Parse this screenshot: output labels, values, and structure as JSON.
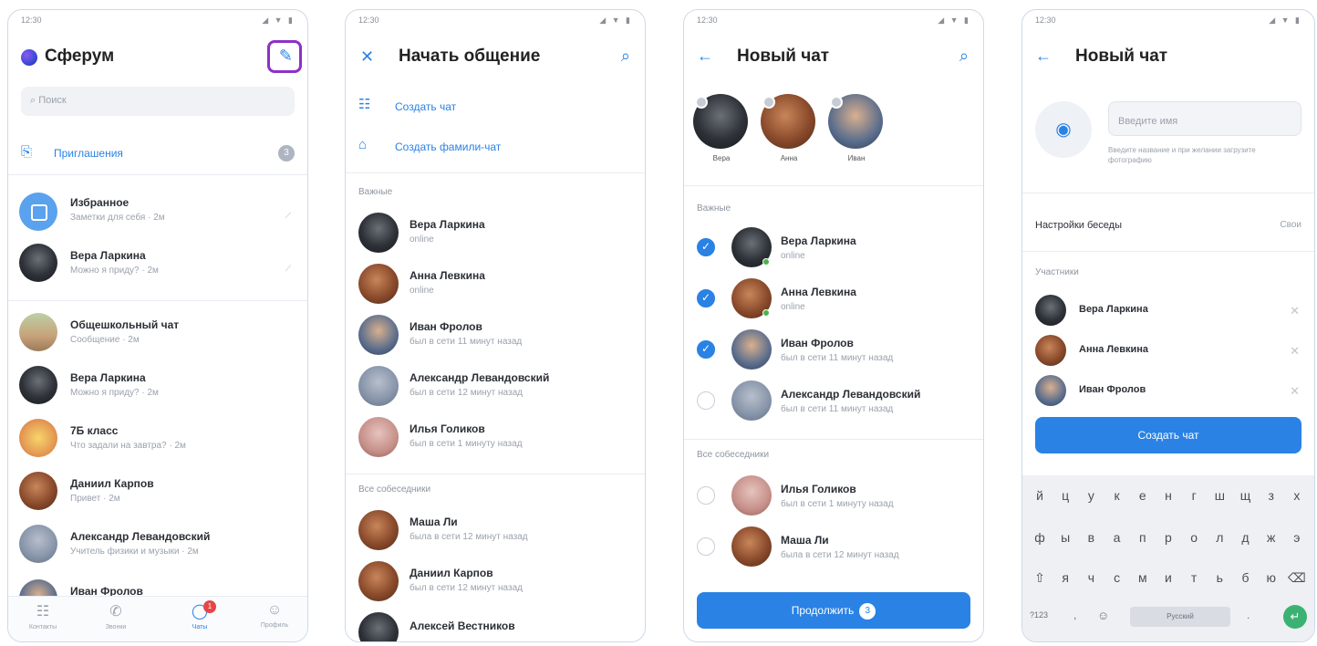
{
  "status": {
    "time": "12:30",
    "icons": "◢ ▼ ▮"
  },
  "screen1": {
    "title": "Сферум",
    "search_placeholder": "Поиск",
    "invitations_label": "Приглашения",
    "invitations_count": "3",
    "chats": [
      {
        "name": "Избранное",
        "sub": "Заметки для себя · 2м"
      },
      {
        "name": "Вера Ларкина",
        "sub": "Можно я приду? · 2м"
      },
      {
        "name": "Общешкольный чат",
        "sub": "Сообщение · 2м"
      },
      {
        "name": "Вера Ларкина",
        "sub": "Можно я приду? · 2м"
      },
      {
        "name": "7Б класс",
        "sub": "Что задали на завтра? · 2м"
      },
      {
        "name": "Даниил Карпов",
        "sub": "Привет · 2м"
      },
      {
        "name": "Александр Левандовский",
        "sub": "Учитель физики и музыки · 2м"
      },
      {
        "name": "Иван Фролов",
        "sub": ""
      }
    ],
    "tabs": [
      "Контакты",
      "Звонки",
      "Чаты",
      "Профиль"
    ],
    "tab_badge": "1"
  },
  "screen2": {
    "title": "Начать общение",
    "actions": [
      "Создать чат",
      "Создать фамили-чат"
    ],
    "section_important": "Важные",
    "important": [
      {
        "name": "Вера Ларкина",
        "sub": "online"
      },
      {
        "name": "Анна Левкина",
        "sub": "online"
      },
      {
        "name": "Иван Фролов",
        "sub": "был в сети 11 минут назад"
      },
      {
        "name": "Александр Левандовский",
        "sub": "был в сети 12 минут назад"
      },
      {
        "name": "Илья Голиков",
        "sub": "был в сети 1 минуту назад"
      }
    ],
    "section_all": "Все собеседники",
    "all": [
      {
        "name": "Маша Ли",
        "sub": "была в сети 12 минут назад"
      },
      {
        "name": "Даниил Карпов",
        "sub": "был в сети 12 минут назад"
      },
      {
        "name": "Алексей Вестников",
        "sub": ""
      }
    ]
  },
  "screen3": {
    "title": "Новый чат",
    "selected": [
      "Вера",
      "Анна",
      "Иван"
    ],
    "section_important": "Важные",
    "important": [
      {
        "name": "Вера Ларкина",
        "sub": "online",
        "checked": true
      },
      {
        "name": "Анна Левкина",
        "sub": "online",
        "checked": true
      },
      {
        "name": "Иван Фролов",
        "sub": "был в сети 11 минут назад",
        "checked": true
      },
      {
        "name": "Александр Левандовский",
        "sub": "был в сети 11 минут назад",
        "checked": false
      }
    ],
    "section_all": "Все собеседники",
    "all": [
      {
        "name": "Илья Голиков",
        "sub": "был в сети 1 минуту назад",
        "checked": false
      },
      {
        "name": "Маша Ли",
        "sub": "была в сети 12 минут назад",
        "checked": false
      }
    ],
    "continue_label": "Продолжить",
    "continue_count": "3"
  },
  "screen4": {
    "title": "Новый чат",
    "name_placeholder": "Введите имя",
    "name_hint": "Введите название и при желании загрузите фотографию",
    "settings_label": "Настройки беседы",
    "settings_value": "Свои",
    "section_members": "Участники",
    "members": [
      "Вера Ларкина",
      "Анна Левкина",
      "Иван Фролов"
    ],
    "create_label": "Создать чат",
    "keyboard": {
      "row1": [
        "й",
        "ц",
        "у",
        "к",
        "е",
        "н",
        "г",
        "ш",
        "щ",
        "з",
        "х"
      ],
      "row2": [
        "ф",
        "ы",
        "в",
        "а",
        "п",
        "р",
        "о",
        "л",
        "д",
        "ж",
        "э"
      ],
      "row3": [
        "⇧",
        "я",
        "ч",
        "с",
        "м",
        "и",
        "т",
        "ь",
        "б",
        "ю",
        "⌫"
      ],
      "row4_left": "?123",
      "row4_space": "Русский"
    }
  }
}
